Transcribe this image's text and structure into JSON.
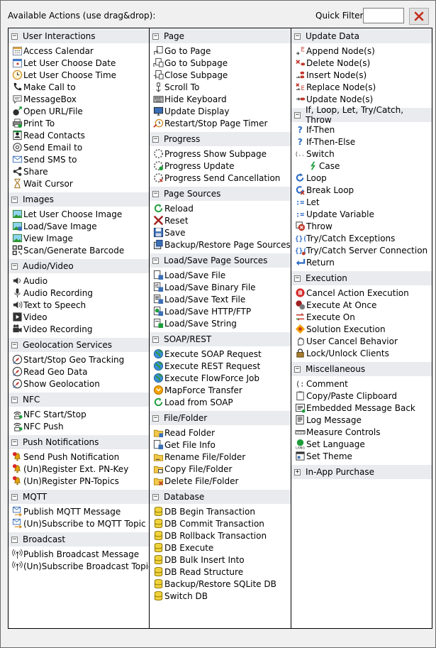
{
  "header": {
    "title": "Available Actions (use drag&drop):",
    "quick_filter_label": "Quick Filter:",
    "quick_filter_value": "",
    "clear_icon": "close-x-icon"
  },
  "colors": {
    "panel_bg": "#ffffff",
    "group_header_bg": "#e9ebef",
    "window_bg": "#f0f0f0",
    "clear_x": "#c42b1c"
  },
  "columns": [
    {
      "groups": [
        {
          "title": "User Interactions",
          "expanded": true,
          "items": [
            {
              "label": "Access Calendar",
              "icon": "calendar-icon"
            },
            {
              "label": "Let User Choose Date",
              "icon": "date-picker-icon"
            },
            {
              "label": "Let User Choose Time",
              "icon": "clock-icon"
            },
            {
              "label": "Make Call to",
              "icon": "phone-icon"
            },
            {
              "label": "MessageBox",
              "icon": "speech-bubble-icon"
            },
            {
              "label": "Open URL/File",
              "icon": "open-url-icon"
            },
            {
              "label": "Print To",
              "icon": "printer-icon"
            },
            {
              "label": "Read Contacts",
              "icon": "contacts-icon"
            },
            {
              "label": "Send Email to",
              "icon": "at-sign-icon"
            },
            {
              "label": "Send SMS to",
              "icon": "envelope-icon"
            },
            {
              "label": "Share",
              "icon": "share-icon"
            },
            {
              "label": "Wait Cursor",
              "icon": "hourglass-icon"
            }
          ]
        },
        {
          "title": "Images",
          "expanded": true,
          "items": [
            {
              "label": "Let User Choose Image",
              "icon": "image-icon"
            },
            {
              "label": "Load/Save Image",
              "icon": "image-save-icon"
            },
            {
              "label": "View Image",
              "icon": "image-view-icon"
            },
            {
              "label": "Scan/Generate Barcode",
              "icon": "qr-code-icon"
            }
          ]
        },
        {
          "title": "Audio/Video",
          "expanded": true,
          "items": [
            {
              "label": "Audio",
              "icon": "speaker-icon"
            },
            {
              "label": "Audio Recording",
              "icon": "microphone-icon"
            },
            {
              "label": "Text to Speech",
              "icon": "speaker-text-icon"
            },
            {
              "label": "Video",
              "icon": "video-icon"
            },
            {
              "label": "Video Recording",
              "icon": "video-camera-icon"
            }
          ]
        },
        {
          "title": "Geolocation Services",
          "expanded": true,
          "items": [
            {
              "label": "Start/Stop Geo Tracking",
              "icon": "compass-icon"
            },
            {
              "label": "Read Geo Data",
              "icon": "compass-icon"
            },
            {
              "label": "Show Geolocation",
              "icon": "compass-icon"
            }
          ]
        },
        {
          "title": "NFC",
          "expanded": true,
          "items": [
            {
              "label": "NFC Start/Stop",
              "icon": "nfc-icon"
            },
            {
              "label": "NFC Push",
              "icon": "nfc-push-icon"
            }
          ]
        },
        {
          "title": "Push Notifications",
          "expanded": true,
          "items": [
            {
              "label": "Send Push Notification",
              "icon": "bell-icon"
            },
            {
              "label": "(Un)Register Ext. PN-Key",
              "icon": "bell-icon"
            },
            {
              "label": "(Un)Register PN-Topics",
              "icon": "bell-icon"
            }
          ]
        },
        {
          "title": "MQTT",
          "expanded": true,
          "items": [
            {
              "label": "Publish MQTT Message",
              "icon": "mail-arrow-icon"
            },
            {
              "label": "(Un)Subscribe to MQTT Topic",
              "icon": "mail-arrow-icon"
            }
          ]
        },
        {
          "title": "Broadcast",
          "expanded": true,
          "items": [
            {
              "label": "Publish Broadcast Message",
              "icon": "broadcast-icon"
            },
            {
              "label": "(Un)Subscribe Broadcast Topic",
              "icon": "broadcast-icon"
            }
          ]
        }
      ]
    },
    {
      "groups": [
        {
          "title": "Page",
          "expanded": true,
          "items": [
            {
              "label": "Go to Page",
              "icon": "page-go-icon"
            },
            {
              "label": "Go to Subpage",
              "icon": "subpage-go-icon"
            },
            {
              "label": "Close Subpage",
              "icon": "subpage-close-icon"
            },
            {
              "label": "Scroll To",
              "icon": "scroll-icon"
            },
            {
              "label": "Hide Keyboard",
              "icon": "keyboard-icon"
            },
            {
              "label": "Update Display",
              "icon": "display-icon"
            },
            {
              "label": "Restart/Stop Page Timer",
              "icon": "timer-icon"
            }
          ]
        },
        {
          "title": "Progress",
          "expanded": true,
          "items": [
            {
              "label": "Progress Show Subpage",
              "icon": "progress-icon"
            },
            {
              "label": "Progress Update",
              "icon": "progress-update-icon"
            },
            {
              "label": "Progress Send Cancellation",
              "icon": "progress-cancel-icon"
            }
          ]
        },
        {
          "title": "Page Sources",
          "expanded": true,
          "items": [
            {
              "label": "Reload",
              "icon": "reload-icon"
            },
            {
              "label": "Reset",
              "icon": "reset-x-icon"
            },
            {
              "label": "Save",
              "icon": "floppy-icon"
            },
            {
              "label": "Backup/Restore Page Sources",
              "icon": "backup-icon"
            }
          ]
        },
        {
          "title": "Load/Save Page Sources",
          "expanded": true,
          "items": [
            {
              "label": "Load/Save File",
              "icon": "file-save-icon"
            },
            {
              "label": "Load/Save Binary File",
              "icon": "binary-file-icon"
            },
            {
              "label": "Load/Save Text File",
              "icon": "text-file-icon"
            },
            {
              "label": "Load/Save HTTP/FTP",
              "icon": "http-file-icon"
            },
            {
              "label": "Load/Save String",
              "icon": "string-file-icon"
            }
          ]
        },
        {
          "title": "SOAP/REST",
          "expanded": true,
          "items": [
            {
              "label": "Execute SOAP Request",
              "icon": "globe-icon"
            },
            {
              "label": "Execute REST Request",
              "icon": "globe-icon"
            },
            {
              "label": "Execute FlowForce Job",
              "icon": "globe-icon"
            },
            {
              "label": "MapForce Transfer",
              "icon": "mapforce-icon"
            },
            {
              "label": "Load from SOAP",
              "icon": "soap-load-icon"
            }
          ]
        },
        {
          "title": "File/Folder",
          "expanded": true,
          "items": [
            {
              "label": "Read Folder",
              "icon": "folder-icon"
            },
            {
              "label": "Get File Info",
              "icon": "file-info-icon"
            },
            {
              "label": "Rename File/Folder",
              "icon": "folder-rename-icon"
            },
            {
              "label": "Copy File/Folder",
              "icon": "folder-copy-icon"
            },
            {
              "label": "Delete File/Folder",
              "icon": "folder-delete-icon"
            }
          ]
        },
        {
          "title": "Database",
          "expanded": true,
          "items": [
            {
              "label": "DB Begin Transaction",
              "icon": "database-icon"
            },
            {
              "label": "DB Commit Transaction",
              "icon": "database-icon"
            },
            {
              "label": "DB Rollback Transaction",
              "icon": "database-icon"
            },
            {
              "label": "DB Execute",
              "icon": "database-icon"
            },
            {
              "label": "DB Bulk Insert Into",
              "icon": "database-icon"
            },
            {
              "label": "DB Read Structure",
              "icon": "database-icon"
            },
            {
              "label": "Backup/Restore SQLite DB",
              "icon": "database-icon"
            },
            {
              "label": "Switch DB",
              "icon": "database-icon"
            }
          ]
        }
      ]
    },
    {
      "groups": [
        {
          "title": "Update Data",
          "expanded": true,
          "items": [
            {
              "label": "Append Node(s)",
              "icon": "node-append-icon"
            },
            {
              "label": "Delete Node(s)",
              "icon": "node-delete-icon"
            },
            {
              "label": "Insert Node(s)",
              "icon": "node-insert-icon"
            },
            {
              "label": "Replace Node(s)",
              "icon": "node-replace-icon"
            },
            {
              "label": "Update Node(s)",
              "icon": "node-update-icon"
            }
          ]
        },
        {
          "title": "If, Loop, Let, Try/Catch, Throw",
          "expanded": true,
          "items": [
            {
              "label": "If-Then",
              "icon": "question-icon"
            },
            {
              "label": "If-Then-Else",
              "icon": "question-icon"
            },
            {
              "label": "Switch",
              "icon": "switch-icon"
            },
            {
              "label": "Case",
              "icon": "case-icon",
              "indent": true
            },
            {
              "label": "Loop",
              "icon": "loop-icon"
            },
            {
              "label": "Break Loop",
              "icon": "break-loop-icon"
            },
            {
              "label": "Let",
              "icon": "let-icon"
            },
            {
              "label": "Update Variable",
              "icon": "variable-icon"
            },
            {
              "label": "Throw",
              "icon": "throw-icon"
            },
            {
              "label": "Try/Catch Exceptions",
              "icon": "try-catch-icon"
            },
            {
              "label": "Try/Catch Server Connection",
              "icon": "try-catch-server-icon"
            },
            {
              "label": "Return",
              "icon": "return-arrow-icon"
            }
          ]
        },
        {
          "title": "Execution",
          "expanded": true,
          "items": [
            {
              "label": "Cancel Action Execution",
              "icon": "hand-stop-icon"
            },
            {
              "label": "Execute At Once",
              "icon": "execute-once-icon"
            },
            {
              "label": "Execute On",
              "icon": "execute-on-icon"
            },
            {
              "label": "Solution Execution",
              "icon": "solution-icon"
            },
            {
              "label": "User Cancel Behavior",
              "icon": "hand-icon"
            },
            {
              "label": "Lock/Unlock Clients",
              "icon": "lock-icon"
            }
          ]
        },
        {
          "title": "Miscellaneous",
          "expanded": true,
          "items": [
            {
              "label": "Comment",
              "icon": "comment-icon"
            },
            {
              "label": "Copy/Paste Clipboard",
              "icon": "clipboard-icon"
            },
            {
              "label": "Embedded Message Back",
              "icon": "embedded-message-icon"
            },
            {
              "label": "Log Message",
              "icon": "log-icon"
            },
            {
              "label": "Measure Controls",
              "icon": "ruler-icon"
            },
            {
              "label": "Set Language",
              "icon": "language-icon"
            },
            {
              "label": "Set Theme",
              "icon": "theme-icon"
            }
          ]
        },
        {
          "title": "In-App Purchase",
          "expanded": false,
          "items": []
        }
      ]
    }
  ]
}
